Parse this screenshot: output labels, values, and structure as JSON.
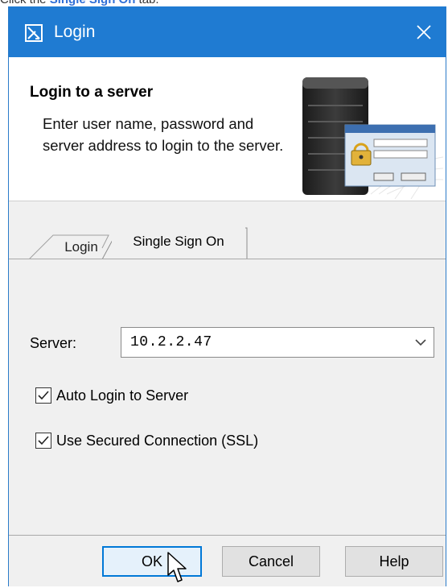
{
  "instruction": {
    "prefix": "Click the",
    "link": "Single Sign On",
    "suffix": "tab."
  },
  "window": {
    "title": "Login"
  },
  "header": {
    "title": "Login to a server",
    "description": "Enter user name, password and server address to login to the server."
  },
  "tabs": [
    {
      "label": "Login",
      "selected": false
    },
    {
      "label": "Single Sign On",
      "selected": true
    }
  ],
  "form": {
    "server_label": "Server:",
    "server_value": "10.2.2.47",
    "checkboxes": [
      {
        "label": "Auto Login to Server",
        "checked": true
      },
      {
        "label": "Use Secured Connection (SSL)",
        "checked": true
      }
    ]
  },
  "buttons": {
    "ok": "OK",
    "cancel": "Cancel",
    "help": "Help"
  },
  "colors": {
    "titlebar": "#1f7bd2",
    "accent": "#0078d7",
    "link": "#2f6fd6"
  }
}
